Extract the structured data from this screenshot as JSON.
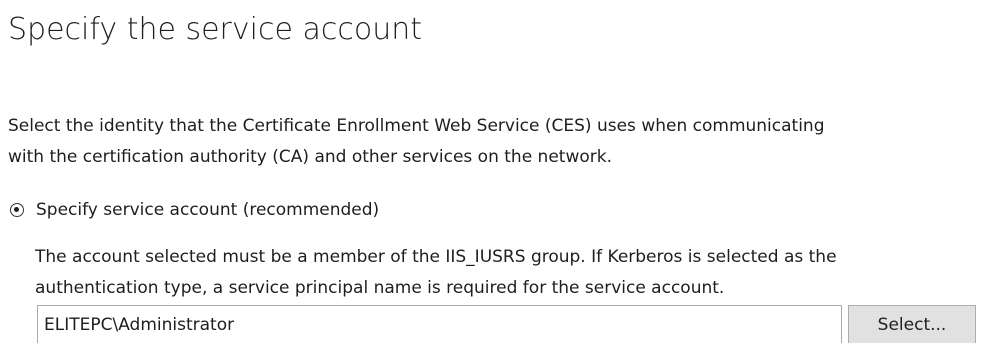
{
  "page": {
    "title": "Specify the service account"
  },
  "description": {
    "line1": "Select the identity that the Certificate Enrollment Web Service (CES) uses when communicating",
    "line2": "with the certification authority (CA) and other services on the network."
  },
  "service_account_option": {
    "label": "Specify service account (recommended)",
    "selected": true,
    "hint_line1": "The account selected must be a member of the IIS_IUSRS group. If Kerberos is selected as the",
    "hint_line2": "authentication type, a service principal name is required for the service account."
  },
  "account_field": {
    "value": "ELITEPC\\Administrator"
  },
  "select_button": {
    "label": "Select..."
  }
}
